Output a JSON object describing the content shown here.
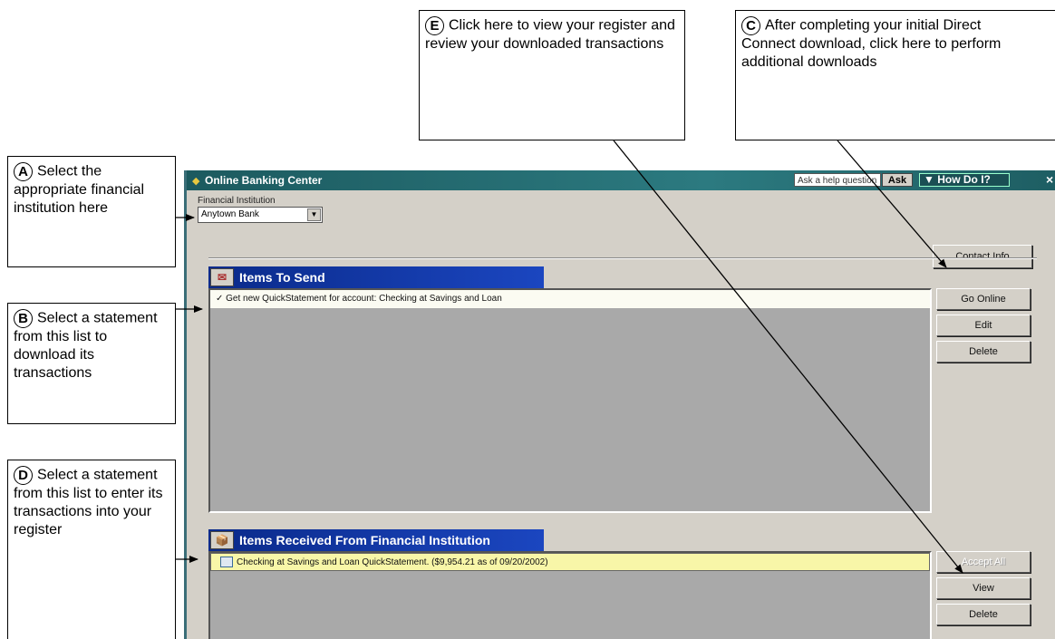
{
  "callouts": {
    "a": {
      "badge": "A",
      "text": "Select the appropriate financial institution here"
    },
    "b": {
      "badge": "B",
      "text": "Select a statement from this list to download its transactions"
    },
    "c": {
      "badge": "C",
      "text": "After completing your initial Direct Connect download, click here to perform additional downloads"
    },
    "d": {
      "badge": "D",
      "text": "Select a statement from this list to enter its transactions into your register"
    },
    "e": {
      "badge": "E",
      "text": "Click here to view your register and review your downloaded transactions"
    }
  },
  "window": {
    "title": "Online Banking Center",
    "ask_placeholder": "Ask a help question",
    "ask_button": "Ask",
    "how_do_i": "▼ How Do I?",
    "close": "×"
  },
  "financial_institution": {
    "label": "Financial Institution",
    "selected": "Anytown Bank"
  },
  "buttons": {
    "contact_info": "Contact Info",
    "go_online": "Go Online",
    "edit": "Edit",
    "delete_send": "Delete",
    "accept_all": "Accept All",
    "view": "View",
    "delete_recv": "Delete"
  },
  "items_to_send": {
    "header": "Items To Send",
    "rows": [
      "✓ Get new QuickStatement for account: Checking at Savings and Loan"
    ]
  },
  "items_received": {
    "header": "Items Received From Financial Institution",
    "rows": [
      "Checking at Savings and Loan QuickStatement.   ($9,954.21 as of 09/20/2002)"
    ]
  },
  "colors": {
    "titlebar": "#1c5a5f",
    "section_header": "#0a2a8a",
    "list_bg": "#a9a9a9",
    "received_row": "#f8f6a8"
  }
}
